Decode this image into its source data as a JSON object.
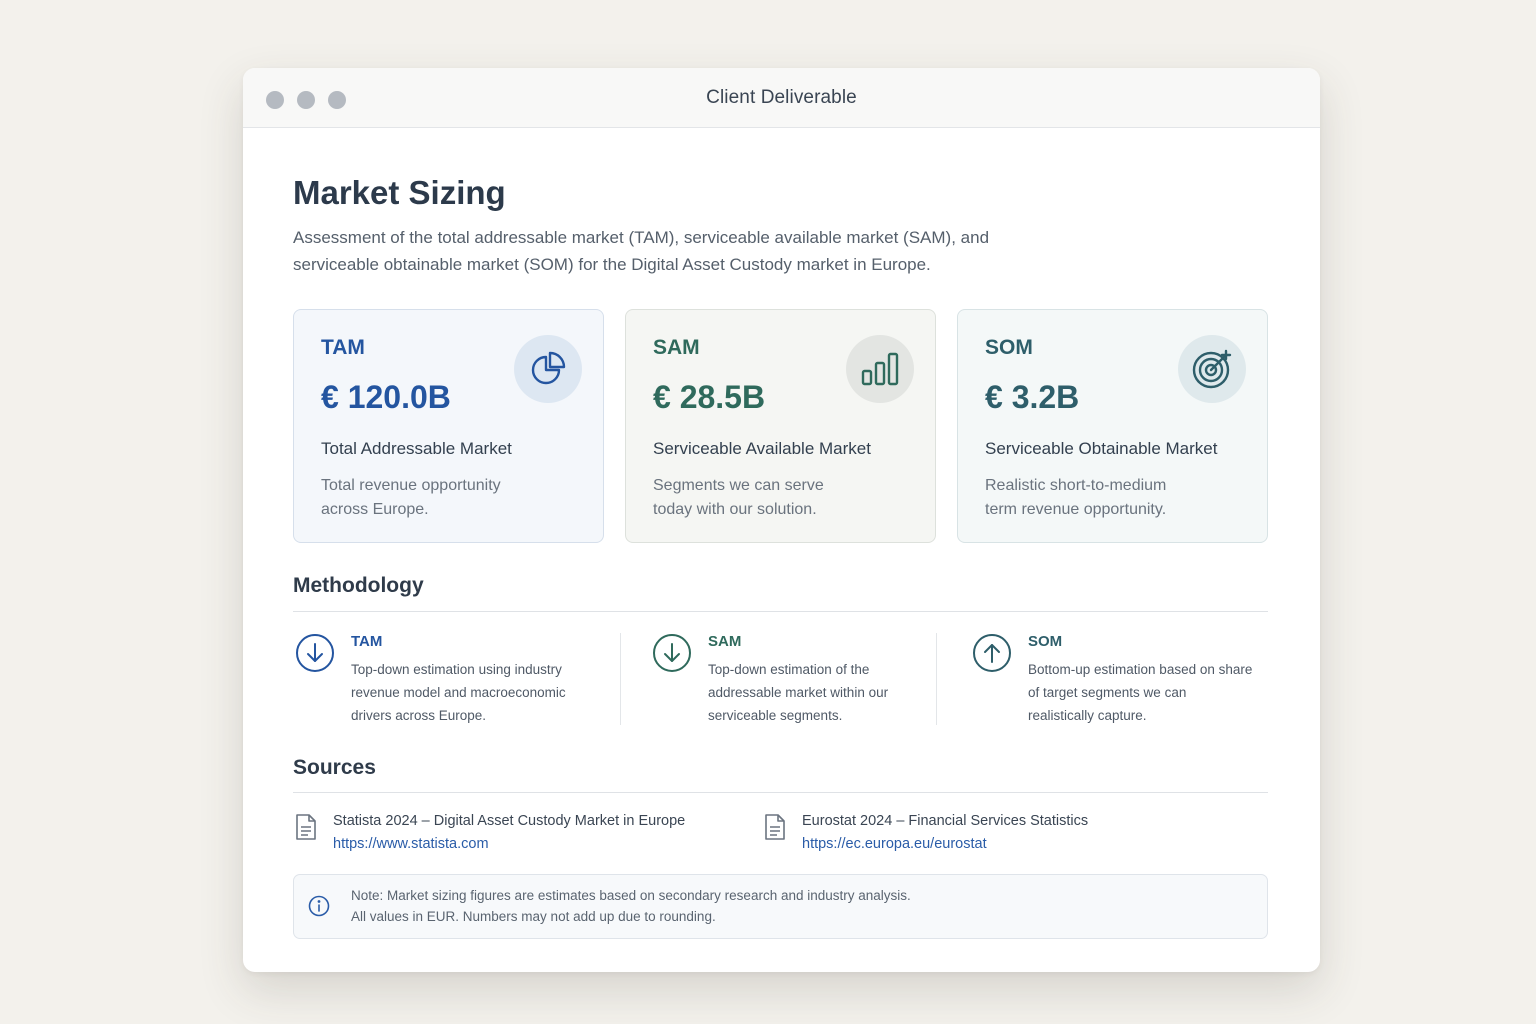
{
  "window": {
    "title": "Client Deliverable"
  },
  "header": {
    "title": "Market Sizing",
    "subtitle": "Assessment of the total addressable market (TAM), serviceable available market (SAM), and serviceable obtainable market (SOM) for the Digital Asset Custody market in Europe."
  },
  "cards": [
    {
      "label": "TAM",
      "value": "€ 120.0B",
      "name": "Total Addressable Market",
      "description": "Total revenue opportunity across Europe.",
      "icon": "pie-chart-icon",
      "color": "#2455a0"
    },
    {
      "label": "SAM",
      "value": "€ 28.5B",
      "name": "Serviceable Available Market",
      "description": "Segments we can serve today with our solution.",
      "icon": "bar-chart-icon",
      "color": "#2f6a5c"
    },
    {
      "label": "SOM",
      "value": "€ 3.2B",
      "name": "Serviceable Obtainable Market",
      "description": "Realistic short-to-medium term revenue opportunity.",
      "icon": "target-icon",
      "color": "#2e5e6a"
    }
  ],
  "methodology": {
    "title": "Methodology",
    "items": [
      {
        "label": "TAM",
        "text": "Top-down estimation using industry revenue model and macroeconomic drivers across Europe.",
        "icon": "arrow-down-circle-icon"
      },
      {
        "label": "SAM",
        "text": "Top-down estimation of the addressable market within our serviceable segments.",
        "icon": "arrow-down-circle-icon"
      },
      {
        "label": "SOM",
        "text": "Bottom-up estimation based on share of target segments we can realistically capture.",
        "icon": "arrow-up-circle-icon"
      }
    ]
  },
  "sources": {
    "title": "Sources",
    "items": [
      {
        "title": "Statista 2024 – Digital Asset Custody Market in Europe",
        "link": "https://www.statista.com",
        "icon": "document-icon"
      },
      {
        "title": "Eurostat 2024 – Financial Services Statistics",
        "link": "https://ec.europa.eu/eurostat",
        "icon": "document-icon"
      }
    ]
  },
  "note": {
    "line1": "Note: Market sizing figures are estimates based on secondary research and industry analysis.",
    "line2": "All values in EUR. Numbers may not add up due to rounding.",
    "icon": "info-icon"
  }
}
